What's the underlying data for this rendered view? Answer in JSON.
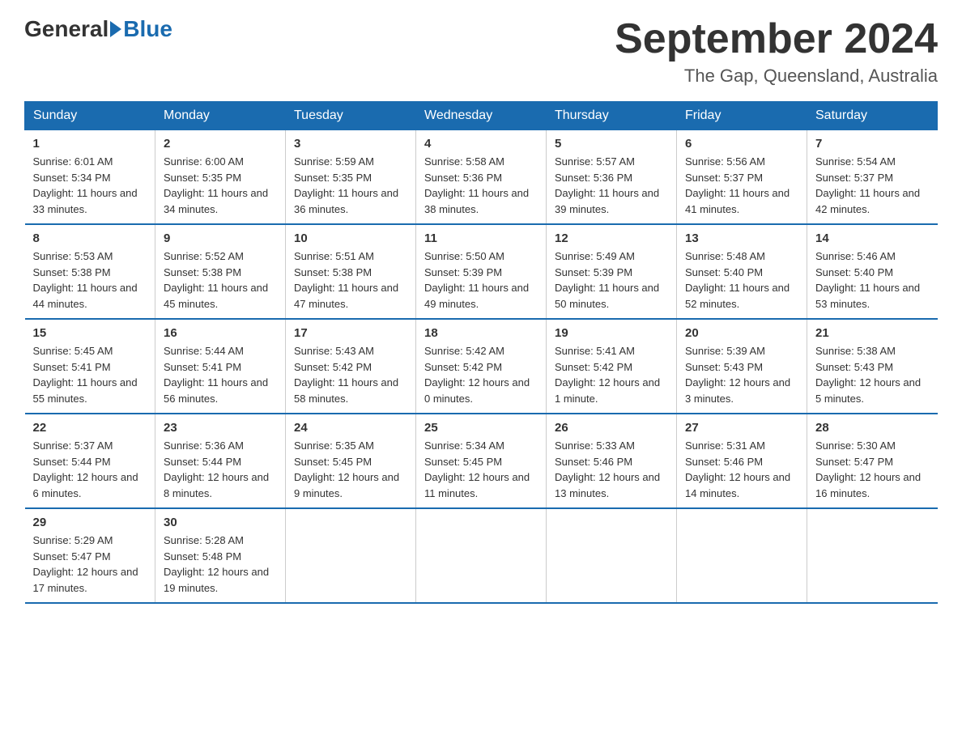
{
  "header": {
    "logo_general": "General",
    "logo_blue": "Blue",
    "month_year": "September 2024",
    "location": "The Gap, Queensland, Australia"
  },
  "days_of_week": [
    "Sunday",
    "Monday",
    "Tuesday",
    "Wednesday",
    "Thursday",
    "Friday",
    "Saturday"
  ],
  "weeks": [
    [
      {
        "day": "1",
        "sunrise": "6:01 AM",
        "sunset": "5:34 PM",
        "daylight": "11 hours and 33 minutes."
      },
      {
        "day": "2",
        "sunrise": "6:00 AM",
        "sunset": "5:35 PM",
        "daylight": "11 hours and 34 minutes."
      },
      {
        "day": "3",
        "sunrise": "5:59 AM",
        "sunset": "5:35 PM",
        "daylight": "11 hours and 36 minutes."
      },
      {
        "day": "4",
        "sunrise": "5:58 AM",
        "sunset": "5:36 PM",
        "daylight": "11 hours and 38 minutes."
      },
      {
        "day": "5",
        "sunrise": "5:57 AM",
        "sunset": "5:36 PM",
        "daylight": "11 hours and 39 minutes."
      },
      {
        "day": "6",
        "sunrise": "5:56 AM",
        "sunset": "5:37 PM",
        "daylight": "11 hours and 41 minutes."
      },
      {
        "day": "7",
        "sunrise": "5:54 AM",
        "sunset": "5:37 PM",
        "daylight": "11 hours and 42 minutes."
      }
    ],
    [
      {
        "day": "8",
        "sunrise": "5:53 AM",
        "sunset": "5:38 PM",
        "daylight": "11 hours and 44 minutes."
      },
      {
        "day": "9",
        "sunrise": "5:52 AM",
        "sunset": "5:38 PM",
        "daylight": "11 hours and 45 minutes."
      },
      {
        "day": "10",
        "sunrise": "5:51 AM",
        "sunset": "5:38 PM",
        "daylight": "11 hours and 47 minutes."
      },
      {
        "day": "11",
        "sunrise": "5:50 AM",
        "sunset": "5:39 PM",
        "daylight": "11 hours and 49 minutes."
      },
      {
        "day": "12",
        "sunrise": "5:49 AM",
        "sunset": "5:39 PM",
        "daylight": "11 hours and 50 minutes."
      },
      {
        "day": "13",
        "sunrise": "5:48 AM",
        "sunset": "5:40 PM",
        "daylight": "11 hours and 52 minutes."
      },
      {
        "day": "14",
        "sunrise": "5:46 AM",
        "sunset": "5:40 PM",
        "daylight": "11 hours and 53 minutes."
      }
    ],
    [
      {
        "day": "15",
        "sunrise": "5:45 AM",
        "sunset": "5:41 PM",
        "daylight": "11 hours and 55 minutes."
      },
      {
        "day": "16",
        "sunrise": "5:44 AM",
        "sunset": "5:41 PM",
        "daylight": "11 hours and 56 minutes."
      },
      {
        "day": "17",
        "sunrise": "5:43 AM",
        "sunset": "5:42 PM",
        "daylight": "11 hours and 58 minutes."
      },
      {
        "day": "18",
        "sunrise": "5:42 AM",
        "sunset": "5:42 PM",
        "daylight": "12 hours and 0 minutes."
      },
      {
        "day": "19",
        "sunrise": "5:41 AM",
        "sunset": "5:42 PM",
        "daylight": "12 hours and 1 minute."
      },
      {
        "day": "20",
        "sunrise": "5:39 AM",
        "sunset": "5:43 PM",
        "daylight": "12 hours and 3 minutes."
      },
      {
        "day": "21",
        "sunrise": "5:38 AM",
        "sunset": "5:43 PM",
        "daylight": "12 hours and 5 minutes."
      }
    ],
    [
      {
        "day": "22",
        "sunrise": "5:37 AM",
        "sunset": "5:44 PM",
        "daylight": "12 hours and 6 minutes."
      },
      {
        "day": "23",
        "sunrise": "5:36 AM",
        "sunset": "5:44 PM",
        "daylight": "12 hours and 8 minutes."
      },
      {
        "day": "24",
        "sunrise": "5:35 AM",
        "sunset": "5:45 PM",
        "daylight": "12 hours and 9 minutes."
      },
      {
        "day": "25",
        "sunrise": "5:34 AM",
        "sunset": "5:45 PM",
        "daylight": "12 hours and 11 minutes."
      },
      {
        "day": "26",
        "sunrise": "5:33 AM",
        "sunset": "5:46 PM",
        "daylight": "12 hours and 13 minutes."
      },
      {
        "day": "27",
        "sunrise": "5:31 AM",
        "sunset": "5:46 PM",
        "daylight": "12 hours and 14 minutes."
      },
      {
        "day": "28",
        "sunrise": "5:30 AM",
        "sunset": "5:47 PM",
        "daylight": "12 hours and 16 minutes."
      }
    ],
    [
      {
        "day": "29",
        "sunrise": "5:29 AM",
        "sunset": "5:47 PM",
        "daylight": "12 hours and 17 minutes."
      },
      {
        "day": "30",
        "sunrise": "5:28 AM",
        "sunset": "5:48 PM",
        "daylight": "12 hours and 19 minutes."
      },
      null,
      null,
      null,
      null,
      null
    ]
  ]
}
